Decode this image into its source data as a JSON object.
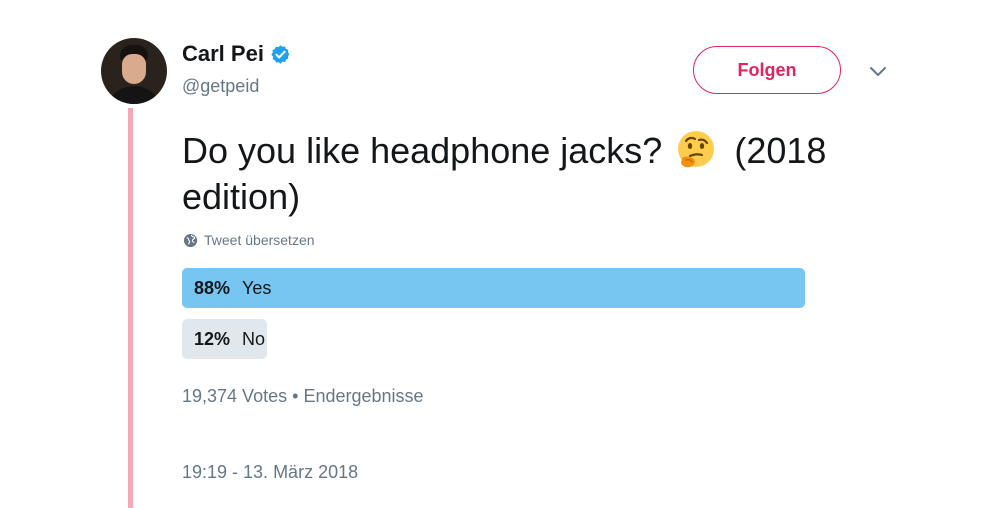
{
  "author": {
    "name": "Carl Pei",
    "handle": "@getpeid",
    "verified": true
  },
  "header": {
    "follow_label": "Folgen",
    "menu_icon": "chevron-down-icon"
  },
  "tweet": {
    "text_before_emoji": "Do you like headphone jacks? ",
    "emoji": "thinking-face",
    "text_after_emoji": " (2018 edition)",
    "translate_label": "Tweet übersetzen"
  },
  "poll": {
    "options": [
      {
        "percent": "88%",
        "label": "Yes",
        "share": 0.88,
        "winner": true
      },
      {
        "percent": "12%",
        "label": "No",
        "share": 0.12,
        "winner": false
      }
    ],
    "votes": "19,374 Votes",
    "separator": "•",
    "status": "Endergebnisse"
  },
  "timestamp": "19:19 - 13. März 2018",
  "colors": {
    "accent_follow": "#e0245e",
    "poll_winner": "#77c6f2",
    "poll_loser": "#e1e8ed",
    "thread_line": "#f4a7b5",
    "muted_text": "#657786",
    "verified_badge": "#1da1f2"
  }
}
